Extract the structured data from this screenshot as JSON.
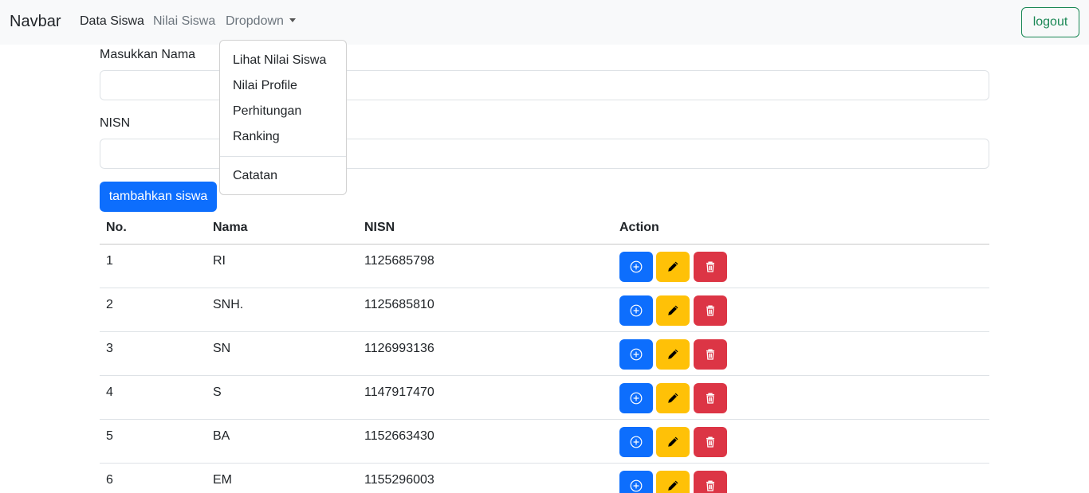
{
  "navbar": {
    "brand": "Navbar",
    "links": [
      "Data Siswa",
      "Nilai Siswa",
      "Dropdown"
    ],
    "logout": "logout"
  },
  "dropdown": {
    "items": [
      "Lihat Nilai Siswa",
      "Nilai Profile",
      "Perhitungan",
      "Ranking"
    ],
    "after_divider": "Catatan"
  },
  "form": {
    "nama_label": "Masukkan Nama",
    "nama_value": "",
    "nisn_label": "NISN",
    "nisn_value": "",
    "submit": "tambahkan siswa"
  },
  "table": {
    "headers": [
      "No.",
      "Nama",
      "NISN",
      "Action"
    ],
    "rows": [
      {
        "no": "1",
        "nama": "RI",
        "nisn": "1125685798"
      },
      {
        "no": "2",
        "nama": "SNH.",
        "nisn": "1125685810"
      },
      {
        "no": "3",
        "nama": "SN",
        "nisn": "1126993136"
      },
      {
        "no": "4",
        "nama": "S",
        "nisn": "1147917470"
      },
      {
        "no": "5",
        "nama": "BA",
        "nisn": "1152663430"
      },
      {
        "no": "6",
        "nama": "EM",
        "nisn": "1155296003"
      }
    ],
    "action_icons": [
      "plus-circle-icon",
      "pencil-icon",
      "trash-icon"
    ]
  },
  "colors": {
    "primary": "#0d6efd",
    "warning": "#ffc107",
    "danger": "#dc3545",
    "success": "#198754",
    "navbar_bg": "#f8f9fa"
  }
}
